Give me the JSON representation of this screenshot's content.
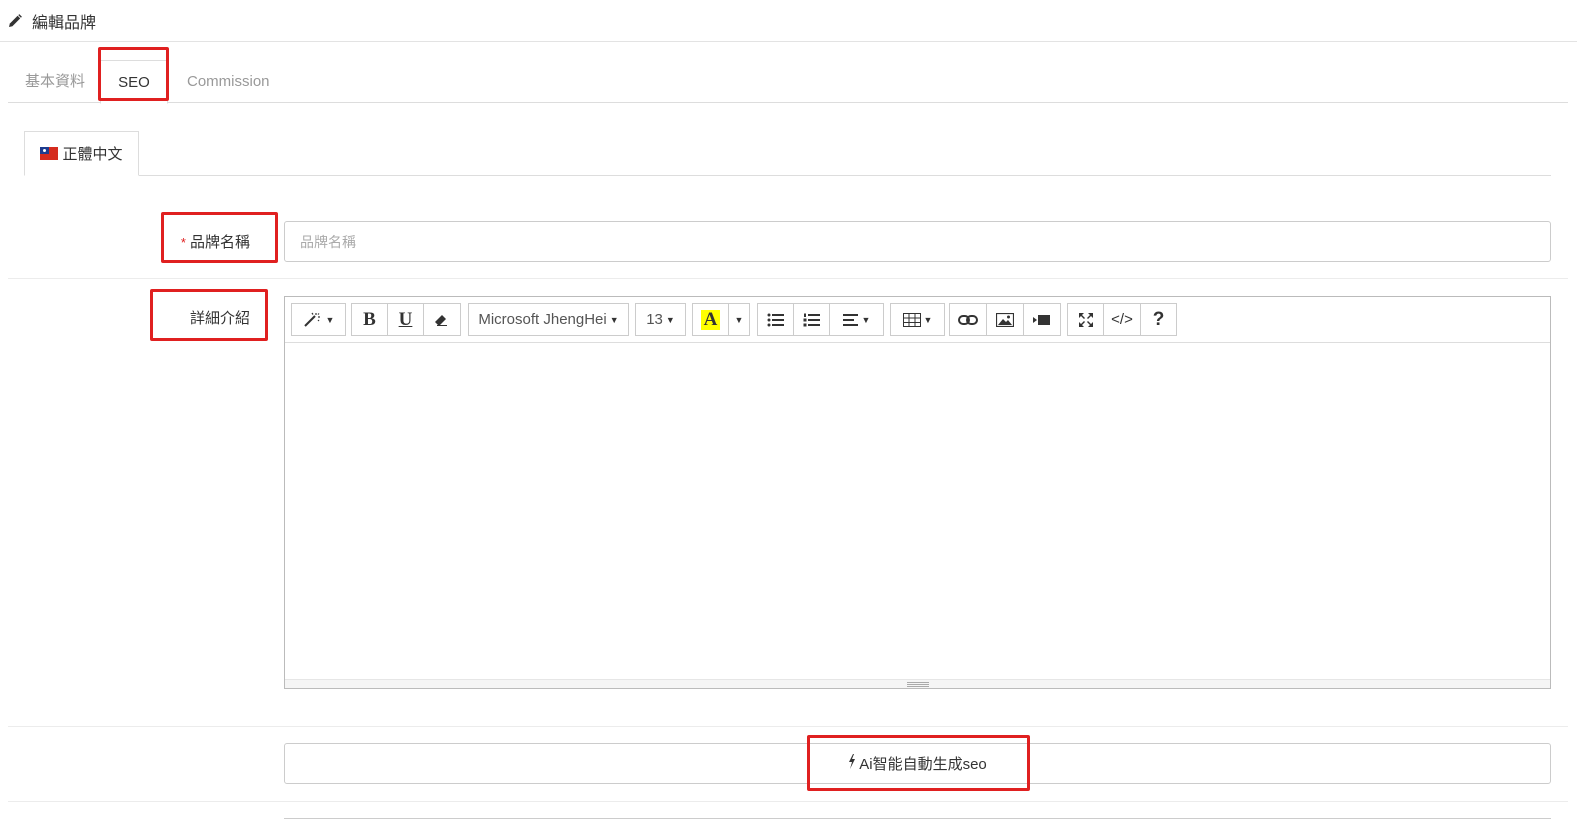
{
  "header": {
    "title": "編輯品牌",
    "icon": "pencil-icon"
  },
  "tabs": [
    {
      "label": "基本資料",
      "active": false
    },
    {
      "label": "SEO",
      "active": true
    },
    {
      "label": "Commission",
      "active": false
    }
  ],
  "language_tab": {
    "label": "正體中文",
    "flag_icon": "taiwan-flag-icon"
  },
  "form": {
    "brand_name": {
      "label": "品牌名稱",
      "required_mark": "*",
      "placeholder": "品牌名稱",
      "value": ""
    },
    "description": {
      "label": "詳細介紹"
    }
  },
  "editor_toolbar": {
    "font_family": "Microsoft JhengHei",
    "font_size": "13",
    "bold": "B",
    "underline": "U",
    "highlight_letter": "A",
    "code_view": "</>",
    "help": "?"
  },
  "ai_button": {
    "label": "Ai智能自動生成seo",
    "icon": "bolt-icon"
  },
  "colors": {
    "highlight_box": "#e02020",
    "required": "#e02020",
    "highlight_bg": "#ffff00"
  }
}
